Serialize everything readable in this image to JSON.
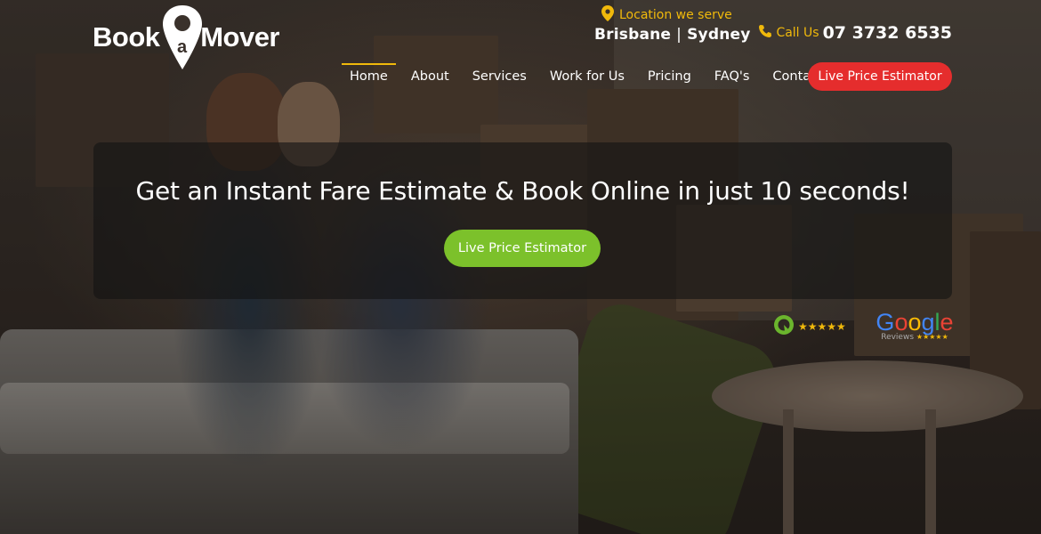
{
  "header": {
    "logo": {
      "word1": "Book",
      "pin_letter": "a",
      "word2": "Mover",
      "pin_icon": "map-pin-icon"
    },
    "location_label": "Location we serve",
    "location_icon": "map-marker-icon",
    "cities": [
      "Brisbane",
      "Sydney"
    ],
    "city_separator": "|",
    "phone_label": "Call Us",
    "phone_number": "07 3732 6535",
    "phone_icon": "phone-icon"
  },
  "nav": {
    "items": [
      {
        "label": "Home",
        "active": true
      },
      {
        "label": "About",
        "active": false
      },
      {
        "label": "Services",
        "active": false
      },
      {
        "label": "Work for Us",
        "active": false
      },
      {
        "label": "Pricing",
        "active": false
      },
      {
        "label": "FAQ's",
        "active": false
      },
      {
        "label": "Contact",
        "active": false
      }
    ],
    "cta_label": "Live Price Estimator"
  },
  "hero": {
    "title": "Get an Instant Fare Estimate & Book Online in just 10 seconds!",
    "cta_label": "Live Price Estimator"
  },
  "reviews": {
    "productreview_stars": "★★★★★",
    "google_word": [
      "G",
      "o",
      "o",
      "g",
      "l",
      "e"
    ],
    "google_sub": "Reviews",
    "google_stars": "★★★★★"
  },
  "colors": {
    "accent_yellow": "#f0b90b",
    "cta_red": "#e52d2d",
    "cta_green": "#7cc12b",
    "google_blue": "#4285f4",
    "google_red": "#ea4335",
    "google_yellow": "#fbbc05",
    "google_green": "#34a853"
  }
}
